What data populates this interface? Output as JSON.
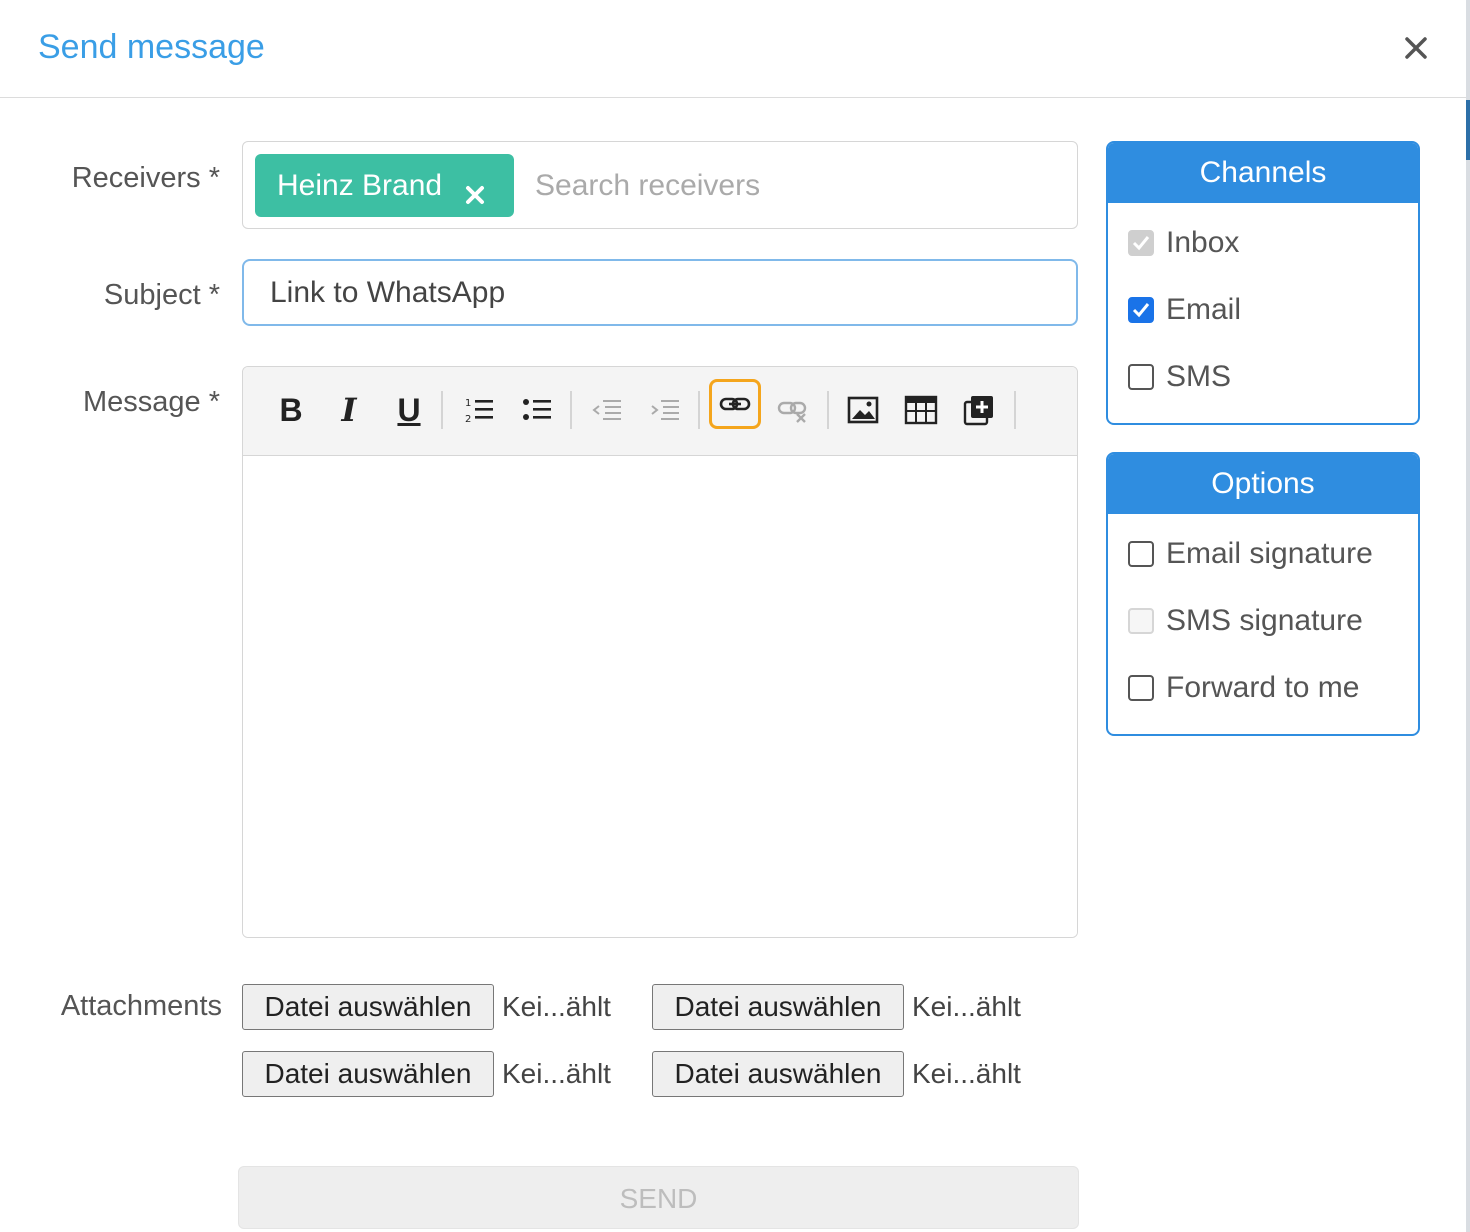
{
  "dialog": {
    "title": "Send message"
  },
  "form": {
    "receivers_label": "Receivers *",
    "receiver_chip": "Heinz Brand",
    "receivers_placeholder": "Search receivers",
    "subject_label": "Subject *",
    "subject_value": "Link to WhatsApp",
    "message_label": "Message *",
    "attachments_label": "Attachments",
    "file_button_label": "Datei auswählen",
    "file_status": "Kei...ählt",
    "send_label": "SEND"
  },
  "toolbar": {
    "bold": "B",
    "italic": "I",
    "underline": "U",
    "highlighted_tool": "link-icon"
  },
  "channels": {
    "title": "Channels",
    "items": [
      {
        "label": "Inbox",
        "checked": true,
        "disabled": true
      },
      {
        "label": "Email",
        "checked": true,
        "disabled": false
      },
      {
        "label": "SMS",
        "checked": false,
        "disabled": false
      }
    ]
  },
  "options": {
    "title": "Options",
    "items": [
      {
        "label": "Email signature",
        "checked": false,
        "disabled": false
      },
      {
        "label": "SMS signature",
        "checked": false,
        "disabled": true
      },
      {
        "label": "Forward to me",
        "checked": false,
        "disabled": false
      }
    ]
  },
  "colors": {
    "accent": "#2f8de0",
    "title": "#3a9ee6",
    "chip": "#3dbfa3",
    "highlight": "#f4a51c"
  }
}
